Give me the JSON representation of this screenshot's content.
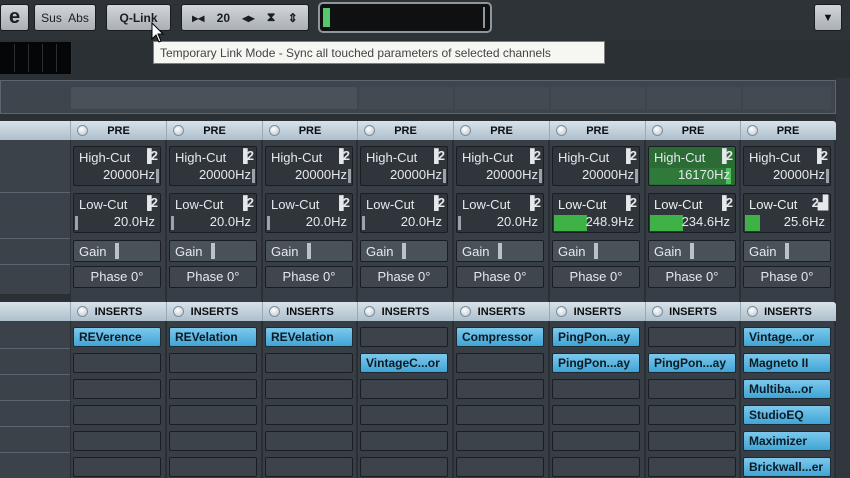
{
  "toolbar": {
    "e_label": "e",
    "sus_label": "Sus",
    "abs_label": "Abs",
    "qlink_label": "Q-Link",
    "nav_value": "20",
    "dropdown_glyph": "▼"
  },
  "tooltip": {
    "text": "Temporary Link Mode - Sync all touched parameters of selected channels"
  },
  "pre_label": "PRE",
  "inserts_label": "INSERTS",
  "channels": [
    {
      "highcut_name": "High-Cut",
      "highcut_val": "20000Hz",
      "highcut_on": false,
      "highcut_fill": 0,
      "lowcut_name": "Low-Cut",
      "lowcut_val": "20.0Hz",
      "lowcut_on": false,
      "lowcut_fill": 0,
      "gain": "Gain",
      "phase": "Phase 0°",
      "inserts": [
        "REVerence",
        "",
        "",
        "",
        "",
        ""
      ]
    },
    {
      "highcut_name": "High-Cut",
      "highcut_val": "20000Hz",
      "highcut_on": false,
      "highcut_fill": 0,
      "lowcut_name": "Low-Cut",
      "lowcut_val": "20.0Hz",
      "lowcut_on": false,
      "lowcut_fill": 0,
      "gain": "Gain",
      "phase": "Phase 0°",
      "inserts": [
        "REVelation",
        "",
        "",
        "",
        "",
        ""
      ]
    },
    {
      "highcut_name": "High-Cut",
      "highcut_val": "20000Hz",
      "highcut_on": false,
      "highcut_fill": 0,
      "lowcut_name": "Low-Cut",
      "lowcut_val": "20.0Hz",
      "lowcut_on": false,
      "lowcut_fill": 0,
      "gain": "Gain",
      "phase": "Phase 0°",
      "inserts": [
        "REVelation",
        "",
        "",
        "",
        "",
        ""
      ]
    },
    {
      "highcut_name": "High-Cut",
      "highcut_val": "20000Hz",
      "highcut_on": false,
      "highcut_fill": 0,
      "lowcut_name": "Low-Cut",
      "lowcut_val": "20.0Hz",
      "lowcut_on": false,
      "lowcut_fill": 0,
      "gain": "Gain",
      "phase": "Phase 0°",
      "inserts": [
        "",
        "VintageC...or",
        "",
        "",
        "",
        ""
      ]
    },
    {
      "highcut_name": "High-Cut",
      "highcut_val": "20000Hz",
      "highcut_on": false,
      "highcut_fill": 0,
      "lowcut_name": "Low-Cut",
      "lowcut_val": "20.0Hz",
      "lowcut_on": false,
      "lowcut_fill": 0,
      "gain": "Gain",
      "phase": "Phase 0°",
      "inserts": [
        "Compressor",
        "",
        "",
        "",
        "",
        ""
      ]
    },
    {
      "highcut_name": "High-Cut",
      "highcut_val": "20000Hz",
      "highcut_on": false,
      "highcut_fill": 0,
      "lowcut_name": "Low-Cut",
      "lowcut_val": "248.9Hz",
      "lowcut_on": true,
      "lowcut_fill": 0.38,
      "gain": "Gain",
      "phase": "Phase 0°",
      "inserts": [
        "PingPon...ay",
        "PingPon...ay",
        "",
        "",
        "",
        ""
      ]
    },
    {
      "highcut_name": "High-Cut",
      "highcut_val": "16170Hz",
      "highcut_on": true,
      "highcut_fill": 0.94,
      "lowcut_name": "Low-Cut",
      "lowcut_val": "234.6Hz",
      "lowcut_on": true,
      "lowcut_fill": 0.38,
      "gain": "Gain",
      "phase": "Phase 0°",
      "inserts": [
        "",
        "PingPon...ay",
        "",
        "",
        "",
        ""
      ]
    },
    {
      "highcut_name": "High-Cut",
      "highcut_val": "20000Hz",
      "highcut_on": false,
      "highcut_fill": 0,
      "lowcut_name": "Low-Cut",
      "lowcut_val": "25.6Hz",
      "lowcut_on": true,
      "lowcut_fill": 0.17,
      "gain": "Gain",
      "phase": "Phase 0°",
      "inserts": [
        "Vintage...or",
        "Magneto II",
        "Multiba...or",
        "StudioEQ",
        "Maximizer",
        "Brickwall...er"
      ]
    }
  ],
  "colors": {
    "accent": "#3ea5d6",
    "filter_active": "#3fb247"
  }
}
